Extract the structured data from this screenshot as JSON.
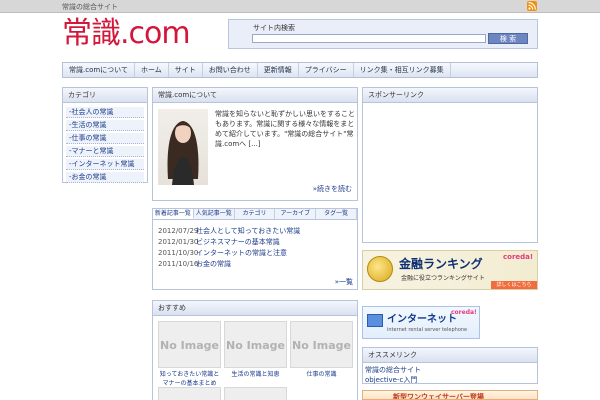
{
  "topbar": {
    "tagline": "常識の総合サイト"
  },
  "site": {
    "logo": "常識.com"
  },
  "search": {
    "label": "サイト内検索",
    "button": "検 索"
  },
  "nav": {
    "items": [
      "常識.comについて",
      "ホーム",
      "サイト",
      "お問い合わせ",
      "更新情報",
      "プライバシー",
      "リンク集・相互リンク募集"
    ]
  },
  "sidebar": {
    "title": "カテゴリ",
    "items": [
      "-社会人の常識",
      "-生活の常識",
      "-仕事の常識",
      "-マナーと常識",
      "-インターネット常識",
      "-お金の常識"
    ]
  },
  "about": {
    "title": "常識.comについて",
    "text": "常識を知らないと恥ずかしい思いをすることもあります。常識に関する様々な情報をまとめて紹介しています。\"常識の総合サイト\"常識.comへ [...]",
    "more": "»続きを読む"
  },
  "posts": {
    "tabs": [
      "新着記事一覧",
      "人気記事一覧",
      "カテゴリ",
      "アーカイブ",
      "タグ一覧"
    ],
    "items": [
      {
        "date": "2012/07/29",
        "title": "社会人として知っておきたい常識"
      },
      {
        "date": "2012/01/30",
        "title": "ビジネスマナーの基本常識"
      },
      {
        "date": "2011/10/30",
        "title": "インターネットの常識と注意"
      },
      {
        "date": "2011/10/16",
        "title": "お金の常識"
      }
    ],
    "more": "»一覧"
  },
  "featured": {
    "title": "おすすめ",
    "items": [
      {
        "image": "No Image",
        "caption": "知っておきたい常識とマナーの基本まとめ"
      },
      {
        "image": "No Image",
        "caption": "生活の常識と知恵"
      },
      {
        "image": "No Image",
        "caption": "仕事の常識"
      }
    ]
  },
  "right": {
    "top_title": "スポンサーリンク",
    "ranking_banner": {
      "title": "金融ランキング",
      "subtitle": "金融に役立つランキングサイト",
      "brand": "coreda!",
      "cta": "詳しくはこちら"
    },
    "internet_banner": {
      "title": "インターネット",
      "subtitle": "ランキング",
      "brand": "coreda!",
      "tags": "internet  rental server  telephone"
    },
    "links": {
      "title": "オススメリンク",
      "items": [
        "常識の総合サイト",
        "objective-c入門"
      ]
    },
    "server_banner": {
      "text": "新型ワンウェイサーバー登場"
    }
  },
  "colors": {
    "logo": "#d2173a",
    "link": "#1a3a8a",
    "panel_border": "#b8c4da"
  }
}
